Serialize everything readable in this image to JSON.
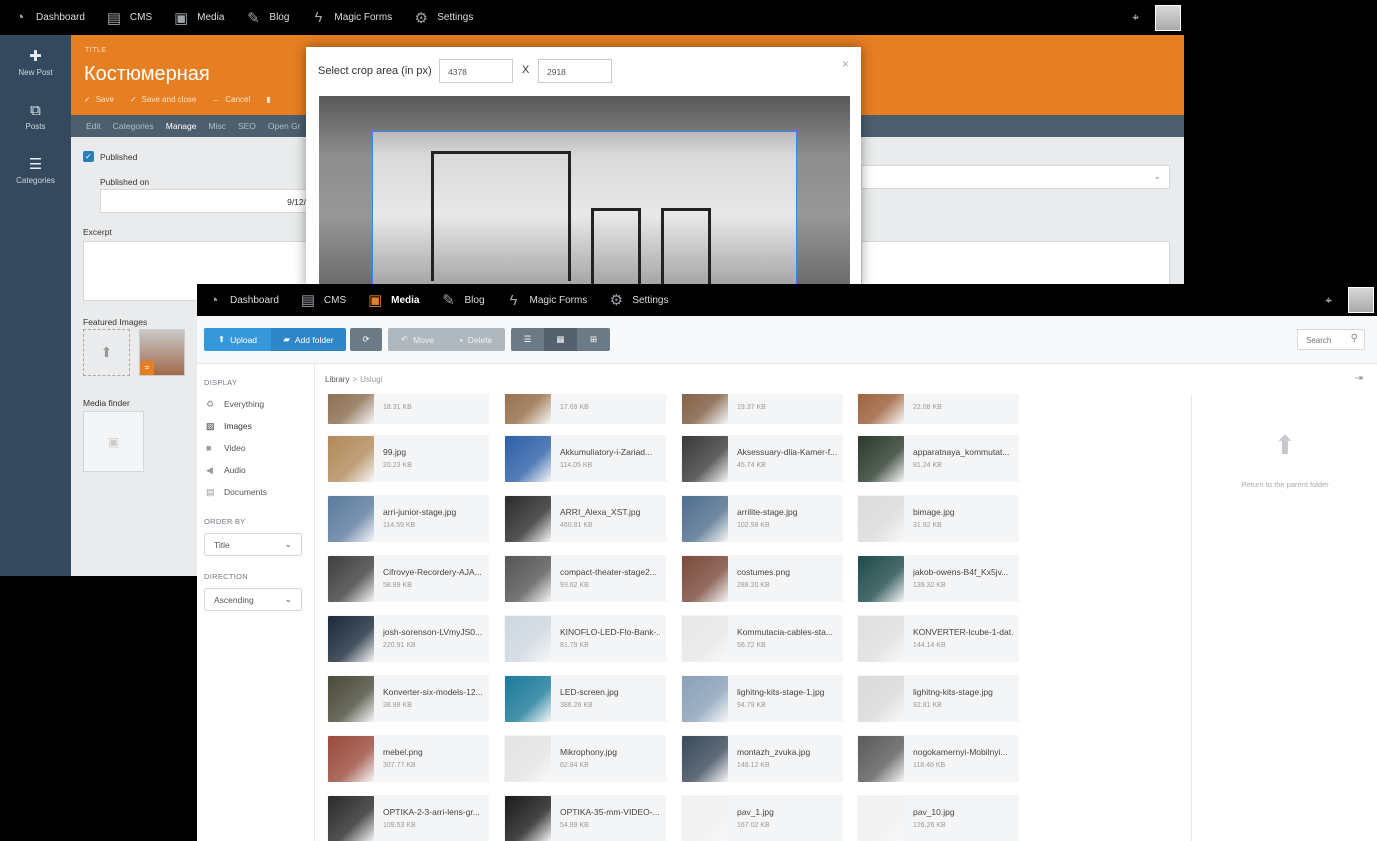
{
  "back_window": {
    "nav": [
      {
        "label": "Dashboard",
        "icon": "dashboard-icon"
      },
      {
        "label": "CMS",
        "icon": "cms-icon"
      },
      {
        "label": "Media",
        "icon": "media-icon"
      },
      {
        "label": "Blog",
        "icon": "blog-icon"
      },
      {
        "label": "Magic Forms",
        "icon": "magic-forms-icon"
      },
      {
        "label": "Settings",
        "icon": "settings-icon"
      }
    ],
    "sidebar": [
      {
        "label": "New Post",
        "glyph": "✚"
      },
      {
        "label": "Posts",
        "glyph": "⧉"
      },
      {
        "label": "Categories",
        "glyph": "☰"
      }
    ],
    "header": {
      "title_label": "TITLE",
      "title": "Костюмерная",
      "actions": [
        "Save",
        "Save and close",
        "Cancel"
      ]
    },
    "tabs": [
      "Edit",
      "Categories",
      "Manage",
      "Misc",
      "SEO",
      "Open Gr"
    ],
    "active_tab": "Manage",
    "form": {
      "published_label": "Published",
      "published_on_label": "Published on",
      "published_on_value": "9/12/",
      "excerpt_label": "Excerpt",
      "featured_images_label": "Featured Images",
      "media_finder_label": "Media finder"
    },
    "crop_modal": {
      "title": "Select crop area (in px)",
      "width": "4378",
      "separator": "X",
      "height": "2918",
      "close": "×"
    }
  },
  "front_window": {
    "nav": [
      {
        "label": "Dashboard",
        "icon": "dashboard-icon"
      },
      {
        "label": "CMS",
        "icon": "cms-icon"
      },
      {
        "label": "Media",
        "icon": "media-icon",
        "active": true
      },
      {
        "label": "Blog",
        "icon": "blog-icon"
      },
      {
        "label": "Magic Forms",
        "icon": "magic-forms-icon"
      },
      {
        "label": "Settings",
        "icon": "settings-icon"
      }
    ],
    "toolbar": {
      "upload": "Upload",
      "add_folder": "Add folder",
      "move": "Move",
      "delete": "Delete",
      "search_placeholder": "Search"
    },
    "display_heading": "DISPLAY",
    "display_items": [
      "Everything",
      "Images",
      "Video",
      "Audio",
      "Documents"
    ],
    "display_active": "Images",
    "order_heading": "ORDER BY",
    "order_value": "Title",
    "direction_heading": "DIRECTION",
    "direction_value": "Ascending",
    "breadcrumb": {
      "root": "Library",
      "sep": ">",
      "current": "Uslugi"
    },
    "parent_folder_text": "Return to the parent folder",
    "files": [
      {
        "name": "",
        "size": "18.31 KB",
        "color": "#8a6a4a"
      },
      {
        "name": "",
        "size": "17.69 KB",
        "color": "#946b44"
      },
      {
        "name": "",
        "size": "19.37 KB",
        "color": "#7e5a3e"
      },
      {
        "name": "",
        "size": "22.08 KB",
        "color": "#9a5c34"
      },
      {
        "name": "99.jpg",
        "size": "20.23 KB",
        "color": "#b38a5a"
      },
      {
        "name": "Akkumuliatory-i-Zariad...",
        "size": "114.05 KB",
        "color": "#2c5fa8"
      },
      {
        "name": "Aksessuary-dlia-Kamer-f...",
        "size": "45.74 KB",
        "color": "#3a3a3a"
      },
      {
        "name": "apparatnaya_kommutat...",
        "size": "81.24 KB",
        "color": "#2a3a2a"
      },
      {
        "name": "arri-junior-stage.jpg",
        "size": "114.59 KB",
        "color": "#5b7b9e"
      },
      {
        "name": "ARRI_Alexa_XST.jpg",
        "size": "460.81 KB",
        "color": "#2b2b2b"
      },
      {
        "name": "arrilite-stage.jpg",
        "size": "102.98 KB",
        "color": "#4f6e8e"
      },
      {
        "name": "bimage.jpg",
        "size": "31.92 KB",
        "color": "#dcdcdc"
      },
      {
        "name": "Cifrovye-Recordery-AJA...",
        "size": "58.89 KB",
        "color": "#3f3f3f"
      },
      {
        "name": "compact-theater-stage2...",
        "size": "93.62 KB",
        "color": "#555555"
      },
      {
        "name": "costumes.png",
        "size": "288.20 KB",
        "color": "#7a4a3a"
      },
      {
        "name": "jakob-owens-B4f_Kx5jv...",
        "size": "139.32 KB",
        "color": "#1f4a4a"
      },
      {
        "name": "josh-sorenson-LVmyJS0...",
        "size": "220.91 KB",
        "color": "#1a2a3a"
      },
      {
        "name": "KINOFLO-LED-Flo-Bank-...",
        "size": "81.79 KB",
        "color": "#cfd8e0"
      },
      {
        "name": "Kommutacia-cables-sta...",
        "size": "56.72 KB",
        "color": "#e8e8e8"
      },
      {
        "name": "KONVERTER-lcube-1-dat...",
        "size": "144.14 KB",
        "color": "#e0e0e0"
      },
      {
        "name": "Konverter-six-models-12...",
        "size": "38.88 KB",
        "color": "#4a4a3a"
      },
      {
        "name": "LED-screen.jpg",
        "size": "386.26 KB",
        "color": "#1a7a9a"
      },
      {
        "name": "lighitng-kits-stage-1.jpg",
        "size": "94.79 KB",
        "color": "#8aa0b8"
      },
      {
        "name": "lighitng-kits-stage.jpg",
        "size": "92.81 KB",
        "color": "#dadada"
      },
      {
        "name": "mebel.png",
        "size": "307.77 KB",
        "color": "#9a4a3a"
      },
      {
        "name": "Mikrophony.jpg",
        "size": "62.84 KB",
        "color": "#e5e5e5"
      },
      {
        "name": "montazh_zvuka.jpg",
        "size": "148.12 KB",
        "color": "#3a4a5a"
      },
      {
        "name": "nogokamernyi-Mobilnyi...",
        "size": "118.46 KB",
        "color": "#5a5a5a"
      },
      {
        "name": "OPTIKA-2-3-arri-lens-gr...",
        "size": "109.53 KB",
        "color": "#2a2a2a"
      },
      {
        "name": "OPTIKA-35-mm-VIDEO-...",
        "size": "54.89 KB",
        "color": "#1a1a1a"
      },
      {
        "name": "pav_1.jpg",
        "size": "167.02 KB",
        "color": "#f2f2f2"
      },
      {
        "name": "pav_10.jpg",
        "size": "126.26 KB",
        "color": "#f2f2f2"
      }
    ]
  }
}
